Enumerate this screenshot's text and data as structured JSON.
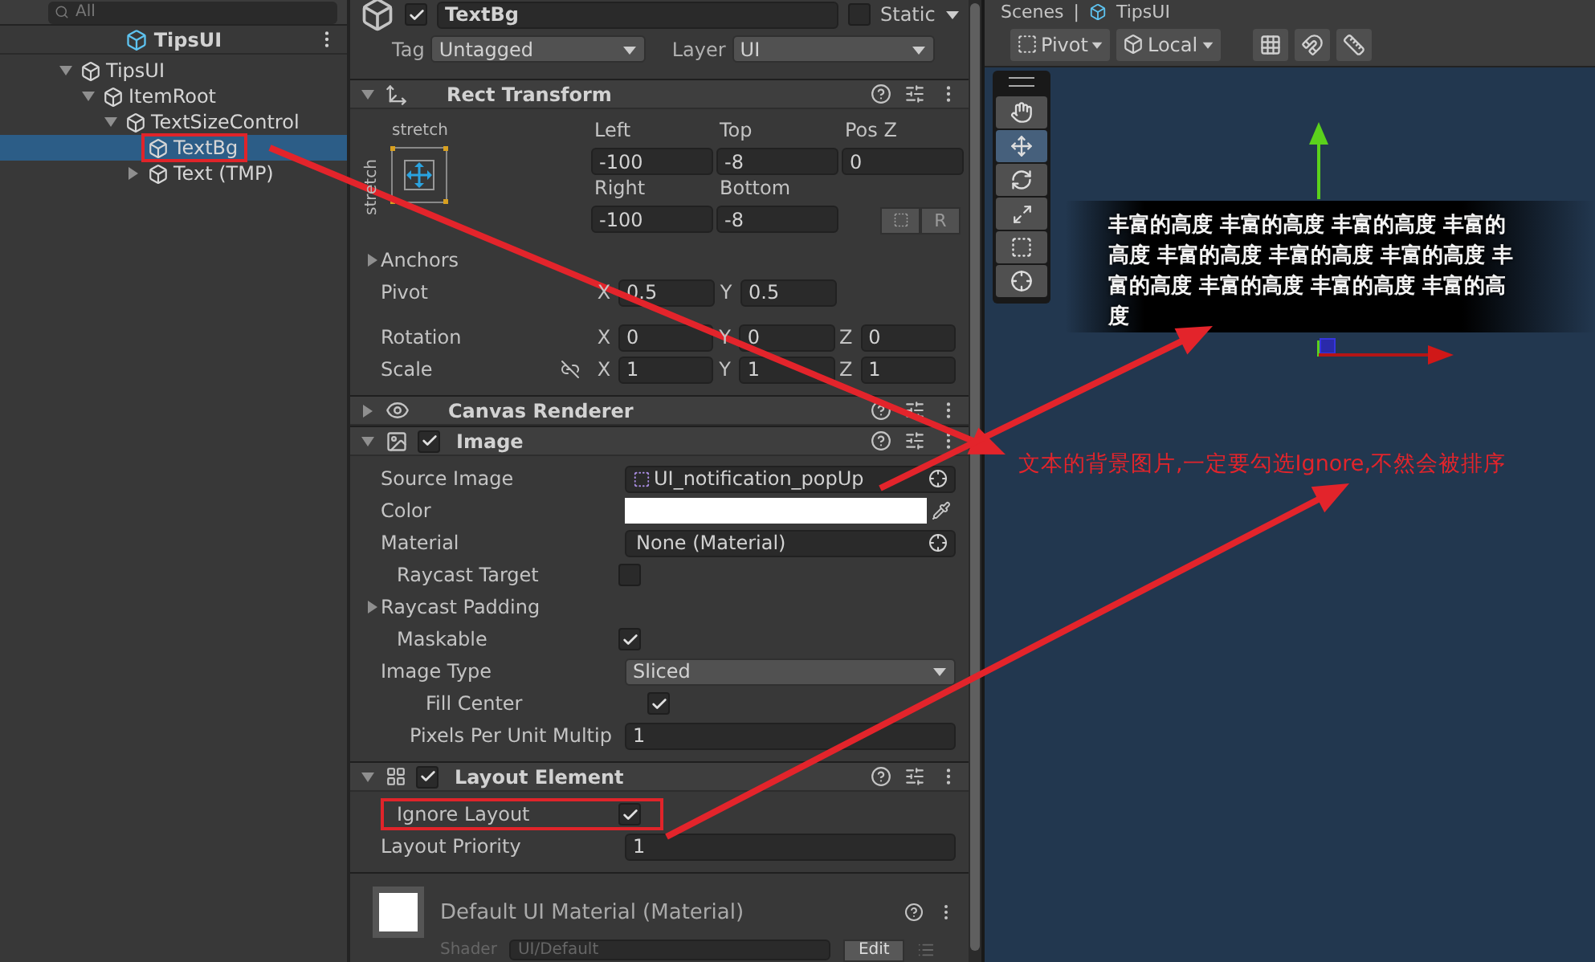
{
  "hierarchy": {
    "search": {
      "placeholder": "All"
    },
    "scene_title": "TipsUI",
    "tree": [
      {
        "label": "TipsUI",
        "expanded": true,
        "selected": false,
        "annotated": false,
        "children": [
          {
            "label": "ItemRoot",
            "expanded": true,
            "selected": false,
            "annotated": false,
            "children": [
              {
                "label": "TextSizeControl",
                "expanded": true,
                "selected": false,
                "annotated": false,
                "children": [
                  {
                    "label": "TextBg",
                    "selected": true,
                    "annotated": true
                  },
                  {
                    "label": "Text (TMP)",
                    "expanded": false,
                    "selected": false,
                    "annotated": false
                  }
                ]
              }
            ]
          }
        ]
      }
    ]
  },
  "inspector": {
    "object": {
      "active": true,
      "name": "TextBg",
      "static": false,
      "static_label": "Static",
      "tag_label": "Tag",
      "tag": "Untagged",
      "layer_label": "Layer",
      "layer": "UI"
    },
    "components": [
      {
        "kind": "rect_transform",
        "title": "Rect Transform",
        "expanded": true,
        "anchor_h": "stretch",
        "anchor_v": "stretch",
        "reset_button": "R",
        "offsets": [
          {
            "label": "Left",
            "value": "-100"
          },
          {
            "label": "Top",
            "value": "-8"
          },
          {
            "label": "Pos Z",
            "value": "0"
          },
          {
            "label": "Right",
            "value": "-100"
          },
          {
            "label": "Bottom",
            "value": "-8"
          }
        ],
        "rows": [
          {
            "kind": "foldout",
            "label": "Anchors",
            "expanded": false
          },
          {
            "kind": "vector",
            "label": "Pivot",
            "axes": [
              {
                "axis": "X",
                "value": "0.5"
              },
              {
                "axis": "Y",
                "value": "0.5"
              }
            ]
          },
          {
            "kind": "vector",
            "label": "Rotation",
            "axes": [
              {
                "axis": "X",
                "value": "0"
              },
              {
                "axis": "Y",
                "value": "0"
              },
              {
                "axis": "Z",
                "value": "0"
              }
            ]
          },
          {
            "kind": "vector",
            "label": "Scale",
            "linked": false,
            "axes": [
              {
                "axis": "X",
                "value": "1"
              },
              {
                "axis": "Y",
                "value": "1"
              },
              {
                "axis": "Z",
                "value": "1"
              }
            ]
          }
        ]
      },
      {
        "kind": "canvas_renderer",
        "title": "Canvas Renderer",
        "expanded": false
      },
      {
        "kind": "image",
        "title": "Image",
        "expanded": true,
        "enabled": true,
        "properties": [
          {
            "kind": "object",
            "label": "Source Image",
            "value": "UI_notification_popUp",
            "asset": true
          },
          {
            "kind": "color",
            "label": "Color"
          },
          {
            "kind": "object",
            "label": "Material",
            "value": "None (Material)",
            "asset": false
          },
          {
            "kind": "checkbox",
            "label": "Raycast Target",
            "checked": false,
            "annotated": false
          },
          {
            "kind": "foldout",
            "label": "Raycast Padding",
            "expanded": false
          },
          {
            "kind": "checkbox",
            "label": "Maskable",
            "checked": true,
            "annotated": false
          },
          {
            "kind": "dropdown",
            "label": "Image Type",
            "value": "Sliced",
            "children": [
              {
                "kind": "checkbox",
                "label": "Fill Center",
                "checked": true,
                "annotated": false
              },
              {
                "kind": "text",
                "label": "Pixels Per Unit Multip",
                "value": "1"
              }
            ]
          }
        ]
      },
      {
        "kind": "layout_element",
        "title": "Layout Element",
        "expanded": true,
        "enabled": true,
        "properties": [
          {
            "kind": "checkbox",
            "label": "Ignore Layout",
            "checked": true,
            "annotated": true
          },
          {
            "kind": "text",
            "label": "Layout Priority",
            "value": "1"
          }
        ]
      },
      {
        "kind": "material",
        "title": "Default UI Material (Material)",
        "shader_label": "Shader",
        "shader": "UI/Default",
        "edit_button": "Edit"
      }
    ]
  },
  "scene": {
    "tab": "Scenes",
    "separator": "|",
    "title": "TipsUI",
    "toolbar": [
      {
        "kind": "pivot",
        "label": "Pivot"
      },
      {
        "kind": "local",
        "label": "Local"
      }
    ],
    "tools": [
      {
        "kind": "hand",
        "selected": false
      },
      {
        "kind": "move",
        "selected": true
      },
      {
        "kind": "rotate",
        "selected": false
      },
      {
        "kind": "scale",
        "selected": false
      },
      {
        "kind": "rect",
        "selected": false
      },
      {
        "kind": "transform",
        "selected": false
      }
    ],
    "preview_text": "丰富的高度 丰富的高度 丰富的高度 丰富的高度 丰富的高度 丰富的高度 丰富的高度 丰富的高度 丰富的高度 丰富的高度 丰富的高度",
    "annotation": "文本的背景图片,一定要勾选Ignore,不然会被排序"
  }
}
